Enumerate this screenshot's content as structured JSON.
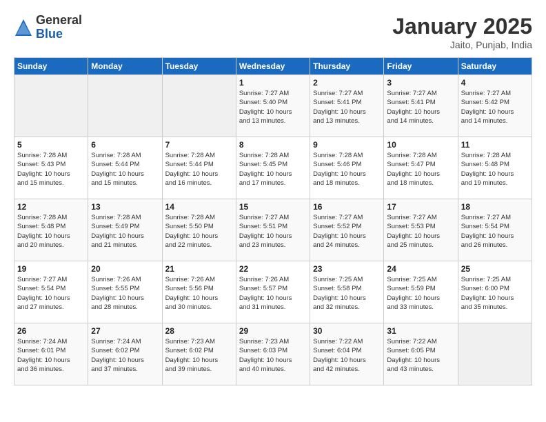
{
  "header": {
    "logo": {
      "general": "General",
      "blue": "Blue"
    },
    "title": "January 2025",
    "subtitle": "Jaito, Punjab, India"
  },
  "days_of_week": [
    "Sunday",
    "Monday",
    "Tuesday",
    "Wednesday",
    "Thursday",
    "Friday",
    "Saturday"
  ],
  "weeks": [
    [
      {
        "day": "",
        "info": ""
      },
      {
        "day": "",
        "info": ""
      },
      {
        "day": "",
        "info": ""
      },
      {
        "day": "1",
        "info": "Sunrise: 7:27 AM\nSunset: 5:40 PM\nDaylight: 10 hours\nand 13 minutes."
      },
      {
        "day": "2",
        "info": "Sunrise: 7:27 AM\nSunset: 5:41 PM\nDaylight: 10 hours\nand 13 minutes."
      },
      {
        "day": "3",
        "info": "Sunrise: 7:27 AM\nSunset: 5:41 PM\nDaylight: 10 hours\nand 14 minutes."
      },
      {
        "day": "4",
        "info": "Sunrise: 7:27 AM\nSunset: 5:42 PM\nDaylight: 10 hours\nand 14 minutes."
      }
    ],
    [
      {
        "day": "5",
        "info": "Sunrise: 7:28 AM\nSunset: 5:43 PM\nDaylight: 10 hours\nand 15 minutes."
      },
      {
        "day": "6",
        "info": "Sunrise: 7:28 AM\nSunset: 5:44 PM\nDaylight: 10 hours\nand 15 minutes."
      },
      {
        "day": "7",
        "info": "Sunrise: 7:28 AM\nSunset: 5:44 PM\nDaylight: 10 hours\nand 16 minutes."
      },
      {
        "day": "8",
        "info": "Sunrise: 7:28 AM\nSunset: 5:45 PM\nDaylight: 10 hours\nand 17 minutes."
      },
      {
        "day": "9",
        "info": "Sunrise: 7:28 AM\nSunset: 5:46 PM\nDaylight: 10 hours\nand 18 minutes."
      },
      {
        "day": "10",
        "info": "Sunrise: 7:28 AM\nSunset: 5:47 PM\nDaylight: 10 hours\nand 18 minutes."
      },
      {
        "day": "11",
        "info": "Sunrise: 7:28 AM\nSunset: 5:48 PM\nDaylight: 10 hours\nand 19 minutes."
      }
    ],
    [
      {
        "day": "12",
        "info": "Sunrise: 7:28 AM\nSunset: 5:48 PM\nDaylight: 10 hours\nand 20 minutes."
      },
      {
        "day": "13",
        "info": "Sunrise: 7:28 AM\nSunset: 5:49 PM\nDaylight: 10 hours\nand 21 minutes."
      },
      {
        "day": "14",
        "info": "Sunrise: 7:28 AM\nSunset: 5:50 PM\nDaylight: 10 hours\nand 22 minutes."
      },
      {
        "day": "15",
        "info": "Sunrise: 7:27 AM\nSunset: 5:51 PM\nDaylight: 10 hours\nand 23 minutes."
      },
      {
        "day": "16",
        "info": "Sunrise: 7:27 AM\nSunset: 5:52 PM\nDaylight: 10 hours\nand 24 minutes."
      },
      {
        "day": "17",
        "info": "Sunrise: 7:27 AM\nSunset: 5:53 PM\nDaylight: 10 hours\nand 25 minutes."
      },
      {
        "day": "18",
        "info": "Sunrise: 7:27 AM\nSunset: 5:54 PM\nDaylight: 10 hours\nand 26 minutes."
      }
    ],
    [
      {
        "day": "19",
        "info": "Sunrise: 7:27 AM\nSunset: 5:54 PM\nDaylight: 10 hours\nand 27 minutes."
      },
      {
        "day": "20",
        "info": "Sunrise: 7:26 AM\nSunset: 5:55 PM\nDaylight: 10 hours\nand 28 minutes."
      },
      {
        "day": "21",
        "info": "Sunrise: 7:26 AM\nSunset: 5:56 PM\nDaylight: 10 hours\nand 30 minutes."
      },
      {
        "day": "22",
        "info": "Sunrise: 7:26 AM\nSunset: 5:57 PM\nDaylight: 10 hours\nand 31 minutes."
      },
      {
        "day": "23",
        "info": "Sunrise: 7:25 AM\nSunset: 5:58 PM\nDaylight: 10 hours\nand 32 minutes."
      },
      {
        "day": "24",
        "info": "Sunrise: 7:25 AM\nSunset: 5:59 PM\nDaylight: 10 hours\nand 33 minutes."
      },
      {
        "day": "25",
        "info": "Sunrise: 7:25 AM\nSunset: 6:00 PM\nDaylight: 10 hours\nand 35 minutes."
      }
    ],
    [
      {
        "day": "26",
        "info": "Sunrise: 7:24 AM\nSunset: 6:01 PM\nDaylight: 10 hours\nand 36 minutes."
      },
      {
        "day": "27",
        "info": "Sunrise: 7:24 AM\nSunset: 6:02 PM\nDaylight: 10 hours\nand 37 minutes."
      },
      {
        "day": "28",
        "info": "Sunrise: 7:23 AM\nSunset: 6:02 PM\nDaylight: 10 hours\nand 39 minutes."
      },
      {
        "day": "29",
        "info": "Sunrise: 7:23 AM\nSunset: 6:03 PM\nDaylight: 10 hours\nand 40 minutes."
      },
      {
        "day": "30",
        "info": "Sunrise: 7:22 AM\nSunset: 6:04 PM\nDaylight: 10 hours\nand 42 minutes."
      },
      {
        "day": "31",
        "info": "Sunrise: 7:22 AM\nSunset: 6:05 PM\nDaylight: 10 hours\nand 43 minutes."
      },
      {
        "day": "",
        "info": ""
      }
    ]
  ]
}
